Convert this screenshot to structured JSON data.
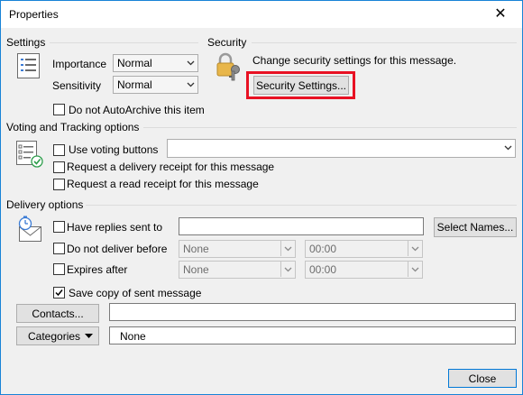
{
  "window": {
    "title": "Properties"
  },
  "settings": {
    "header": "Settings",
    "importance_label": "Importance",
    "importance_value": "Normal",
    "sensitivity_label": "Sensitivity",
    "sensitivity_value": "Normal",
    "autoarchive_label": "Do not AutoArchive this item"
  },
  "security": {
    "header": "Security",
    "description": "Change security settings for this message.",
    "button_label": "Security Settings..."
  },
  "voting": {
    "header": "Voting and Tracking options",
    "use_voting_label": "Use voting buttons",
    "use_voting_value": "",
    "delivery_receipt_label": "Request a delivery receipt for this message",
    "read_receipt_label": "Request a read receipt for this message"
  },
  "delivery": {
    "header": "Delivery options",
    "replies_label": "Have replies sent to",
    "replies_value": "",
    "select_names_label": "Select Names...",
    "do_not_deliver_label": "Do not deliver before",
    "do_not_deliver_date": "None",
    "do_not_deliver_time": "00:00",
    "expires_label": "Expires after",
    "expires_date": "None",
    "expires_time": "00:00",
    "save_copy_label": "Save copy of sent message",
    "save_copy_checked": true
  },
  "contacts": {
    "button_label": "Contacts...",
    "value": ""
  },
  "categories": {
    "button_label": "Categories",
    "value": "None"
  },
  "footer": {
    "close_label": "Close"
  },
  "colors": {
    "highlight": "#e81123",
    "accent": "#0078d7"
  }
}
